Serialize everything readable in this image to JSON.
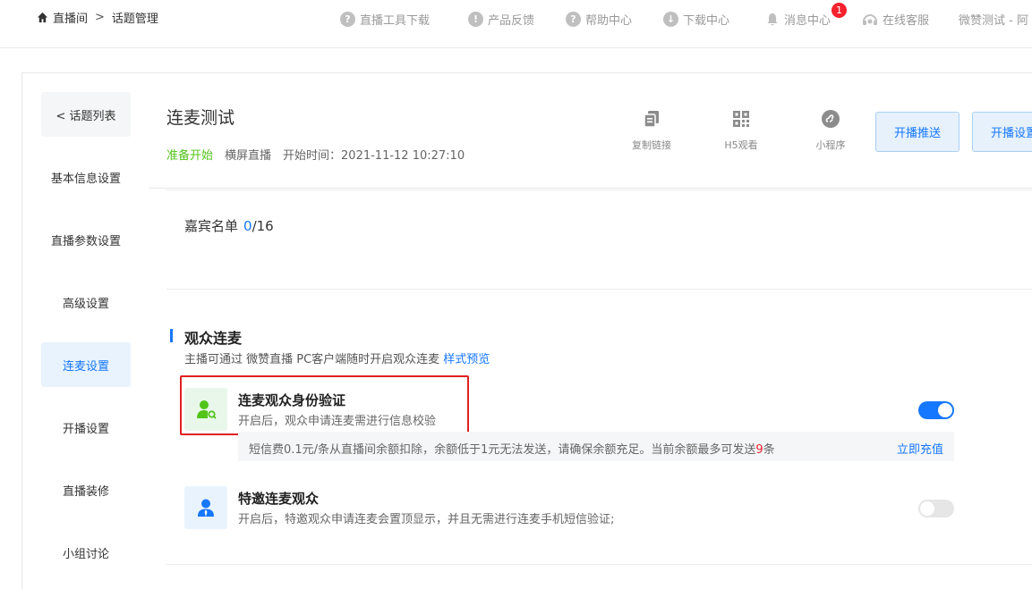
{
  "breadcrumb": {
    "root": "直播间",
    "separator": ">",
    "current": "话题管理"
  },
  "topnav": {
    "items": [
      {
        "label": "直播工具下载",
        "icon": "question-icon"
      },
      {
        "label": "产品反馈",
        "icon": "exclamation-icon"
      },
      {
        "label": "帮助中心",
        "icon": "question-icon"
      },
      {
        "label": "下载中心",
        "icon": "download-icon"
      },
      {
        "label": "消息中心",
        "icon": "bell-icon"
      },
      {
        "label": "在线客服",
        "icon": "headset-icon"
      }
    ],
    "badge_count": "1",
    "user": "微赞测试 - 阿"
  },
  "sidebar": {
    "back_label": "< 话题列表",
    "items": [
      {
        "label": "基本信息设置",
        "active": false
      },
      {
        "label": "直播参数设置",
        "active": false
      },
      {
        "label": "高级设置",
        "active": false
      },
      {
        "label": "连麦设置",
        "active": true
      },
      {
        "label": "开播设置",
        "active": false
      },
      {
        "label": "直播装修",
        "active": false
      },
      {
        "label": "小组讨论",
        "active": false
      }
    ]
  },
  "header": {
    "title": "连麦测试",
    "status": "准备开始",
    "mode": "横屏直播",
    "start_time": "开始时间：2021-11-12 10:27:10",
    "tools": [
      {
        "label": "复制链接",
        "icon": "copy-icon"
      },
      {
        "label": "H5观看",
        "icon": "qrcode-icon"
      },
      {
        "label": "小程序",
        "icon": "mini-program-icon"
      }
    ],
    "buttons": {
      "push": "开播推送",
      "settings": "开播设置"
    }
  },
  "guests": {
    "label": "嘉宾名单",
    "count": "0",
    "total": "/16"
  },
  "audience_mic": {
    "title": "观众连麦",
    "desc": "主播可通过 微赞直播 PC客户端随时开启观众连麦",
    "preview_link": "样式预览",
    "options": [
      {
        "title": "连麦观众身份验证",
        "desc": "开启后，观众申请连麦需进行信息校验",
        "enabled": true,
        "icon": "user-verify-icon",
        "color": "#52c41a"
      },
      {
        "title": "特邀连麦观众",
        "desc": "开启后，特邀观众申请连麦会置顶显示，并且无需进行连麦手机短信验证;",
        "enabled": false,
        "icon": "vip-user-icon",
        "color": "#1677ff"
      }
    ],
    "sms": {
      "text": "短信费0.1元/条从直播间余额扣除，余额低于1元无法发送，请确保余额充足。当前余额最多可发送",
      "count": "9",
      "unit": "条",
      "recharge": "立即充值"
    }
  }
}
